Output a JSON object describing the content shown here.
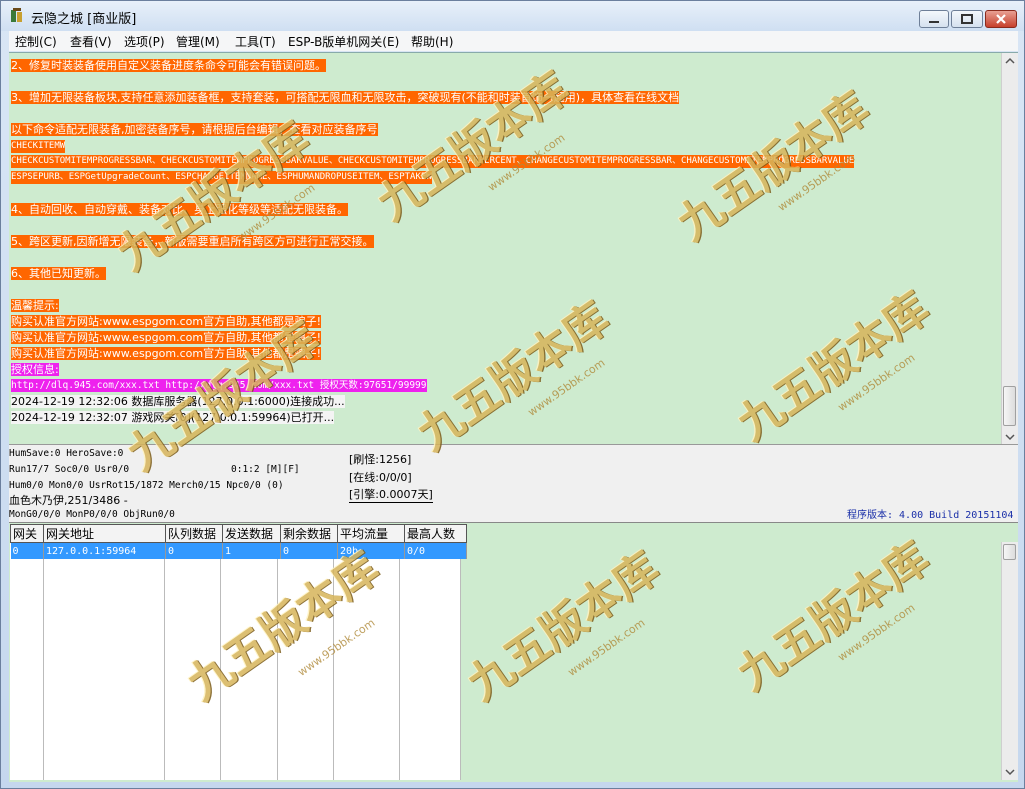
{
  "window": {
    "title": "云隐之城 [商业版]",
    "minimize_label": "minimize",
    "maximize_label": "maximize",
    "close_label": "close"
  },
  "menu": [
    "控制(C)",
    "查看(V)",
    "选项(P)",
    "管理(M)",
    "工具(T)",
    "ESP-B版单机网关(E)",
    "帮助(H)"
  ],
  "log": {
    "lines": [
      "2、修复时装装备使用自定义装备进度条命令可能会有错误问题。",
      "3、增加无限装备板块,支持任意添加装备框，支持套装，可搭配无限血和无限攻击，突破现有(不能和时装首饰一起用)，具体查看在线文档",
      "以下命令适配无限装备,加密装备序号，请根据后台编辑，查看对应装备序号",
      "CHECKITEMW",
      "CHECKCUSTOMITEMPROGRESSBAR、CHECKCUSTOMITEMPROGRESSBARVALUE、CHECKCUSTOMITEMPROGRESSBARPERCENT、CHANGECUSTOMITEMPROGRESSBAR、CHANGECUSTOMITEMPROGRESSBARVALUE",
      "ESPSEPURB、ESPGetUpgradeCount、ESPCHANGEITEMNAME、ESPHUMANDROPUSEITEM、ESPTAKEW",
      "4、自动回收、自动穿戴、装备对比、身上强化等级等适配无限装备。",
      "5、跨区更新,因新增无限装备，新版需要重启所有跨区方可进行正常交接。",
      "6、其他已知更新。",
      "温馨提示:",
      "购买认准官方网站:www.espgom.com官方自助,其他都是骗子!",
      "购买认准官方网站:www.espgom.com官方自助,其他都是骗子!",
      "购买认准官方网站:www.espgom.com官方自助,其他都是骗子!",
      "授权信息:",
      "http://dlq.945.com/xxx.txt http://dlq.945.com/xxx.txt 授权天数:97651/99999",
      "2024-12-19 12:32:06 数据库服务器(127.0.0.1:6000)连接成功...",
      "2024-12-19 12:32:07 游戏网关[0](127.0.0.1:59964)已打开..."
    ]
  },
  "status": {
    "humsave": "HumSave:0 HeroSave:0",
    "run": "Run17/7 Soc0/0 Usr0/0",
    "time": "0:1:2 [M][F]",
    "hum": "Hum0/0 Mon0/0 UsrRot15/1872 Merch0/15 Npc0/0 (0)",
    "monster": "血色木乃伊,251/3486 -",
    "mong": "MonG0/0/0 MonP0/0/0 ObjRun0/0",
    "refresh": "[刷怪:1256]",
    "online": "[在线:0/0/0]",
    "engine": "[引擎:0.0007天]",
    "version": "程序版本: 4.00 Build 20151104"
  },
  "gateway_table": {
    "headers": [
      "网关",
      "网关地址",
      "队列数据",
      "发送数据",
      "剩余数据",
      "平均流量",
      "最高人数"
    ],
    "rows": [
      [
        "0",
        "127.0.0.1:59964",
        "0",
        "1",
        "0",
        "20b",
        "0/0"
      ]
    ]
  },
  "watermark": {
    "text": "九五版本库",
    "sub": "www.95bbk.com"
  },
  "colors": {
    "log_bg": "#ceebcf",
    "highlight_orange": "#ff6600",
    "highlight_magenta": "#ee22ee",
    "selection_blue": "#3399ff",
    "version_text": "#1a2fa8"
  }
}
